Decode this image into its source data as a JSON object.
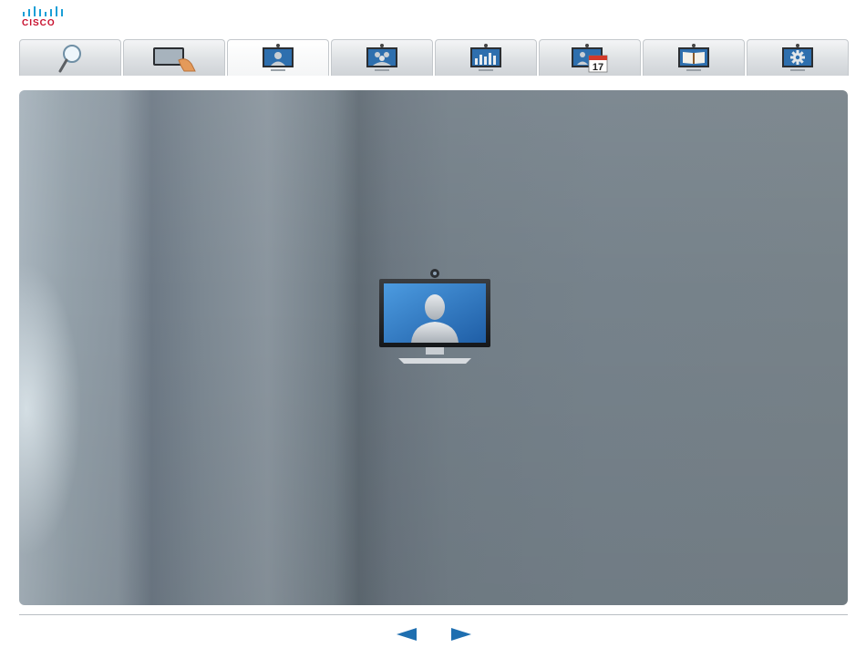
{
  "brand": {
    "name": "CISCO",
    "color": "#c8102e"
  },
  "tabs": [
    {
      "id": "search",
      "icon": "magnifier-icon",
      "active": false
    },
    {
      "id": "touch",
      "icon": "touch-panel-icon",
      "active": false
    },
    {
      "id": "video-call",
      "icon": "video-monitor-person-icon",
      "active": true
    },
    {
      "id": "multipoint",
      "icon": "multipoint-call-icon",
      "active": false
    },
    {
      "id": "presentation",
      "icon": "presentation-chart-icon",
      "active": false
    },
    {
      "id": "scheduling",
      "icon": "calendar-icon",
      "active": false,
      "calendar_day": "17"
    },
    {
      "id": "directory",
      "icon": "book-icon",
      "active": false
    },
    {
      "id": "settings",
      "icon": "gear-icon",
      "active": false
    }
  ],
  "stage": {
    "hero_icon": "video-monitor-person-icon"
  },
  "nav": {
    "prev_icon": "arrow-left-icon",
    "next_icon": "arrow-right-icon",
    "arrow_color": "#1f6fb0"
  }
}
